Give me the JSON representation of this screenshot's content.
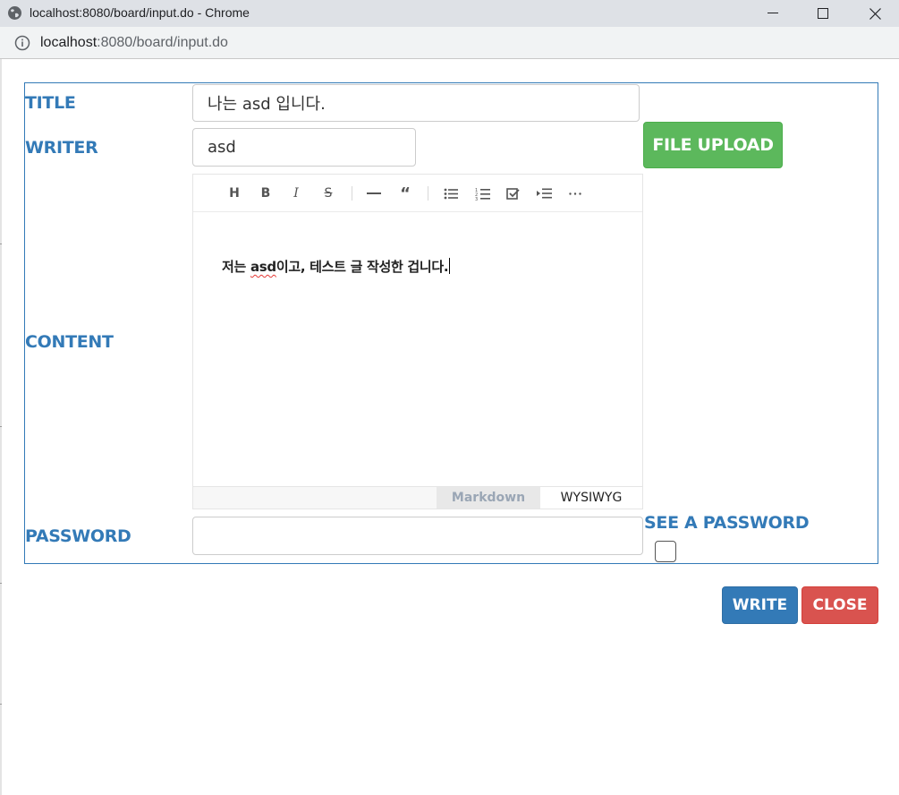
{
  "window": {
    "title": "localhost:8080/board/input.do - Chrome",
    "url_host": "localhost",
    "url_rest": ":8080/board/input.do"
  },
  "form": {
    "title_label": "TITLE",
    "title_value": "나는 asd 입니다.",
    "writer_label": "WRITER",
    "writer_value": "asd",
    "file_upload_label": "FILE UPLOAD",
    "content_label": "CONTENT",
    "password_label": "PASSWORD",
    "password_value": "",
    "see_password_label": "SEE A PASSWORD",
    "see_password_checked": false
  },
  "editor": {
    "toolbar": [
      "heading",
      "bold",
      "italic",
      "strike",
      "hr",
      "quote",
      "ul",
      "ol",
      "task",
      "indent",
      "more"
    ],
    "content_before": "저는 ",
    "content_misspelled": "asd",
    "content_after": "이고, 테스트 글 작성한 겁니다.",
    "mode_markdown": "Markdown",
    "mode_wysiwyg": "WYSIWYG",
    "active_mode": "WYSIWYG"
  },
  "actions": {
    "write_label": "WRITE",
    "close_label": "CLOSE"
  },
  "colors": {
    "primary": "#337ab7",
    "success": "#5cb85c",
    "danger": "#d9534f"
  }
}
